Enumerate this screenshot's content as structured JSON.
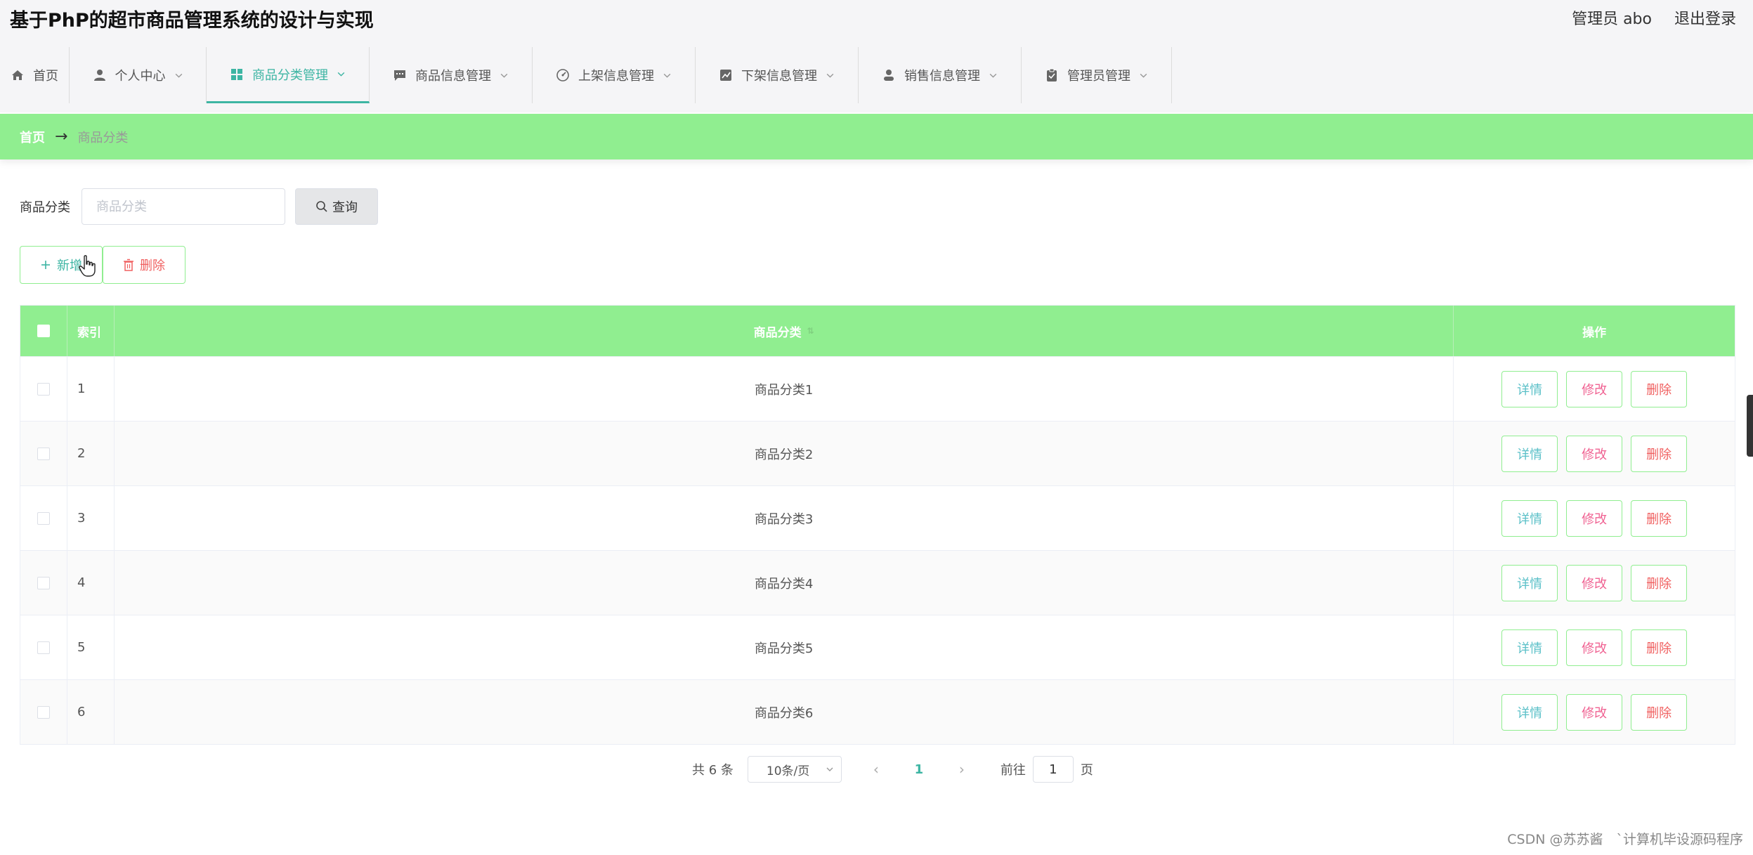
{
  "app": {
    "title": "基于PhP的超市商品管理系统的设计与实现",
    "user_label": "管理员 abo",
    "logout_label": "退出登录"
  },
  "nav": {
    "items": [
      {
        "label": "首页",
        "icon": "home-icon",
        "width": 99,
        "has_dropdown": false
      },
      {
        "label": "个人中心",
        "icon": "user-icon",
        "width": 195,
        "has_dropdown": true
      },
      {
        "label": "商品分类管理",
        "icon": "grid-icon",
        "width": 232,
        "has_dropdown": true
      },
      {
        "label": "商品信息管理",
        "icon": "chat-icon",
        "width": 232,
        "has_dropdown": true
      },
      {
        "label": "上架信息管理",
        "icon": "dashboard-icon",
        "width": 232,
        "has_dropdown": true
      },
      {
        "label": "下架信息管理",
        "icon": "chart-icon",
        "width": 232,
        "has_dropdown": true
      },
      {
        "label": "销售信息管理",
        "icon": "person-icon",
        "width": 232,
        "has_dropdown": true
      },
      {
        "label": "管理员管理",
        "icon": "clipboard-icon",
        "width": 214,
        "has_dropdown": true
      }
    ],
    "active_index": 2
  },
  "breadcrumb": {
    "home": "首页",
    "separator": "→",
    "current": "商品分类"
  },
  "search": {
    "label": "商品分类",
    "placeholder": "商品分类",
    "value": "",
    "button_label": "查询"
  },
  "actions": {
    "add_label": "新增",
    "delete_label": "删除"
  },
  "table": {
    "headers": {
      "index": "索引",
      "name": "商品分类",
      "operation": "操作"
    },
    "rows": [
      {
        "index": "1",
        "name": "商品分类1"
      },
      {
        "index": "2",
        "name": "商品分类2"
      },
      {
        "index": "3",
        "name": "商品分类3"
      },
      {
        "index": "4",
        "name": "商品分类4"
      },
      {
        "index": "5",
        "name": "商品分类5"
      },
      {
        "index": "6",
        "name": "商品分类6"
      }
    ],
    "row_actions": {
      "detail": "详情",
      "edit": "修改",
      "delete": "删除"
    }
  },
  "pagination": {
    "total_text": "共 6 条",
    "page_size": "10条/页",
    "current_page": "1",
    "goto_prefix": "前往",
    "goto_value": "1",
    "goto_suffix": "页"
  },
  "watermark": "CSDN @苏苏酱　`计算机毕设源码程序",
  "colors": {
    "accent": "#3db5a3",
    "header_green": "#90ee90",
    "danger": "#f06060",
    "edit_pink": "#f06292",
    "detail_cyan": "#5bc0c8"
  }
}
